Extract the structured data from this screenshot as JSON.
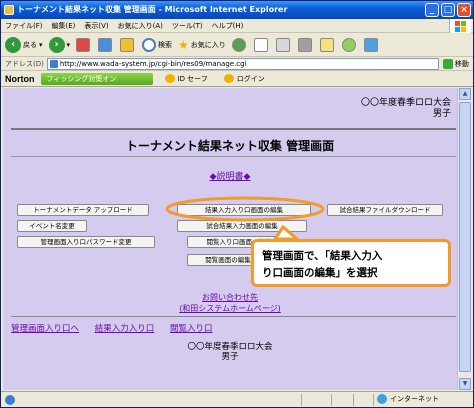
{
  "window": {
    "title": "トーナメント結果ネット収集 管理画面 - Microsoft Internet Explorer",
    "controls": [
      "_",
      "□",
      "×"
    ]
  },
  "menu": [
    "ファイル(F)",
    "編集(E)",
    "表示(V)",
    "お気に入り(A)",
    "ツール(T)",
    "ヘルプ(H)"
  ],
  "toolbar": {
    "back": "戻る",
    "search": "検索",
    "favorites": "お気に入り"
  },
  "address": {
    "label": "アドレス(D)",
    "url": "http://www.wada-system.jp/cgi-bin/res09/manage.cgi",
    "go": "移動"
  },
  "norton": {
    "brand": "Norton",
    "phishing": "フィッシング対策オン",
    "id_safe": "ID セーフ",
    "login": "ログイン"
  },
  "page": {
    "header_line1": "〇〇年度春季ロロ大会",
    "header_line2": "男子",
    "title": "トーナメント結果ネット収集 管理画面",
    "manual": "◆説明書◆",
    "buttons": {
      "tournament_upload": "トーナメントデータ アップロード",
      "event_rename": "イベント名変更",
      "admin_password": "管理画面入り口パスワード変更",
      "result_input_edit": "結果入力入り口画面の編集",
      "match_result_input_edit": "試合結果入力画面の編集",
      "view_entrance_edit": "閲覧入り口画面の編集",
      "view_edit": "閲覧画面の編集",
      "download": "試合結果ファイルダウンロード"
    },
    "inquiry_line1": "お問い合わせ先",
    "inquiry_line2": "(和田システムホームページ)",
    "bottom_links": [
      "管理画面入り口へ",
      "結果入力入り口",
      "閲覧入り口"
    ],
    "footer_line1": "〇〇年度春季ロロ大会",
    "footer_line2": "男子"
  },
  "callout": {
    "line1": "管理画面で、「結果入力入",
    "line2": "り口画面の編集」を選択",
    "border_color": "#f39a2b"
  },
  "status": {
    "zone": "インターネット"
  }
}
